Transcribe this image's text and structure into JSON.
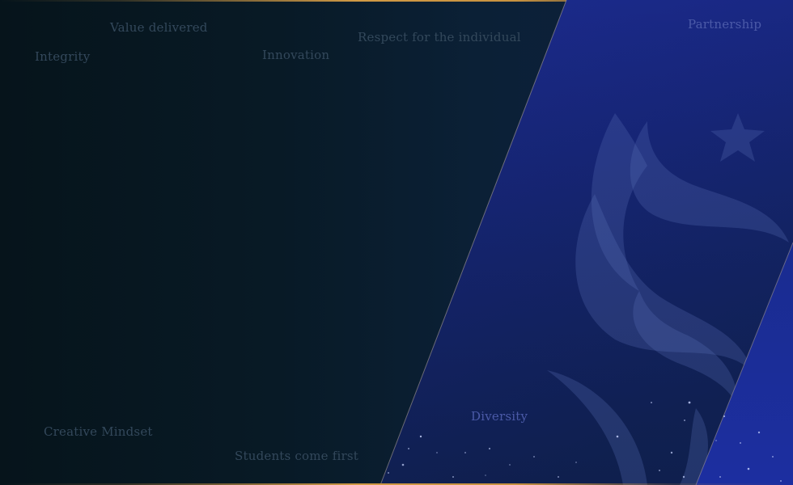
{
  "values": {
    "integrity": "Integrity",
    "value_delivered": "Value delivered",
    "innovation": "Innovation",
    "respect": "Respect for the individual",
    "partnership": "Partnership",
    "diversity": "Diversity",
    "creative_mindset": "Creative Mindset",
    "students_first": "Students come first"
  },
  "colors": {
    "left_background": "#07151c",
    "right_panel": "#1a2a8a",
    "accent_gold": "#d19a45",
    "word_color": "#33485b"
  },
  "icons": {
    "logo_watermark": "flame-star-logo"
  }
}
